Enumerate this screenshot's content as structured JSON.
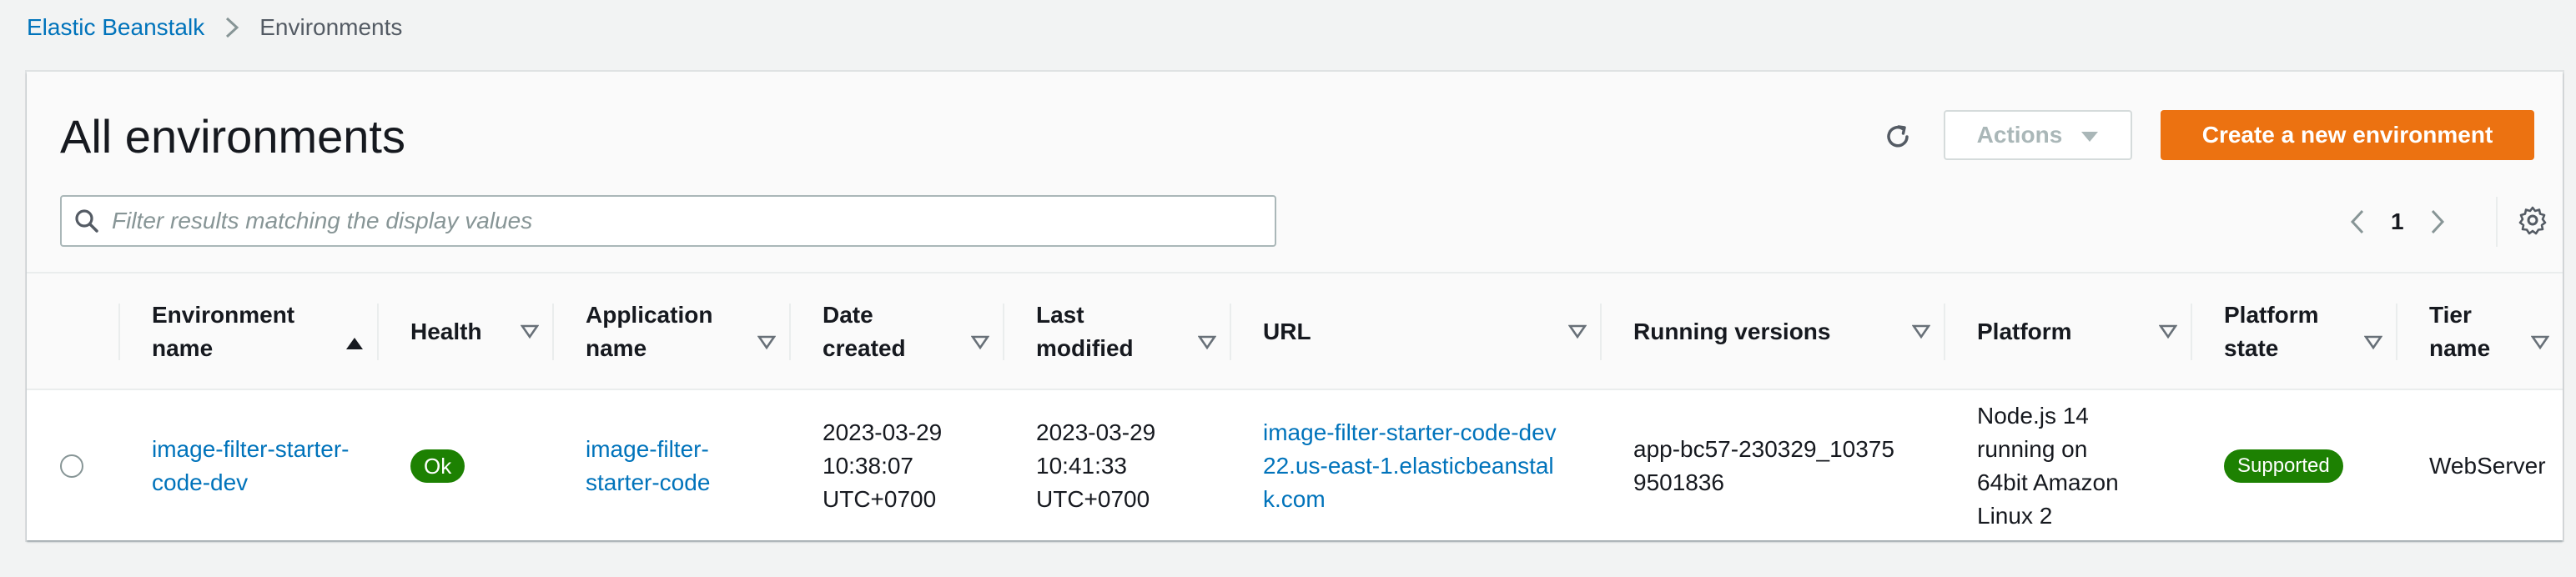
{
  "breadcrumb": {
    "root": "Elastic Beanstalk",
    "current": "Environments"
  },
  "header": {
    "title": "All environments",
    "actions_label": "Actions",
    "create_label": "Create a new environment"
  },
  "filter": {
    "placeholder": "Filter results matching the display values",
    "value": ""
  },
  "pagination": {
    "current_page": "1"
  },
  "table": {
    "columns": [
      {
        "label": "Environment name",
        "sorted": "ascending"
      },
      {
        "label": "Health"
      },
      {
        "label": "Application name"
      },
      {
        "label": "Date created"
      },
      {
        "label": "Last modified"
      },
      {
        "label": "URL"
      },
      {
        "label": "Running versions"
      },
      {
        "label": "Platform"
      },
      {
        "label": "Platform state"
      },
      {
        "label": "Tier name"
      }
    ],
    "rows": [
      {
        "environment_name": "image-filter-starter-code-dev",
        "health": "Ok",
        "application_name": "image-filter-starter-code",
        "date_created": "2023-03-29 10:38:07 UTC+0700",
        "last_modified": "2023-03-29 10:41:33 UTC+0700",
        "url": "image-filter-starter-code-dev22.us-east-1.elasticbeanstalk.com",
        "running_versions": "app-bc57-230329_103759501836",
        "platform": "Node.js 14 running on 64bit Amazon Linux 2",
        "platform_state": "Supported",
        "tier_name": "WebServer"
      }
    ]
  },
  "colors": {
    "link": "#0073bb",
    "primary_button": "#ec7211",
    "status_green": "#1d8102",
    "background": "#f2f3f3"
  },
  "icons": {
    "breadcrumb_separator": "chevron-right-icon",
    "refresh": "refresh-icon",
    "actions_caret": "caret-down-icon",
    "search": "search-icon",
    "prev_page": "chevron-left-icon",
    "next_page": "chevron-right-icon",
    "settings": "gear-icon",
    "sort_ascending": "sort-ascending-icon",
    "sortable": "sortable-caret-icon"
  }
}
